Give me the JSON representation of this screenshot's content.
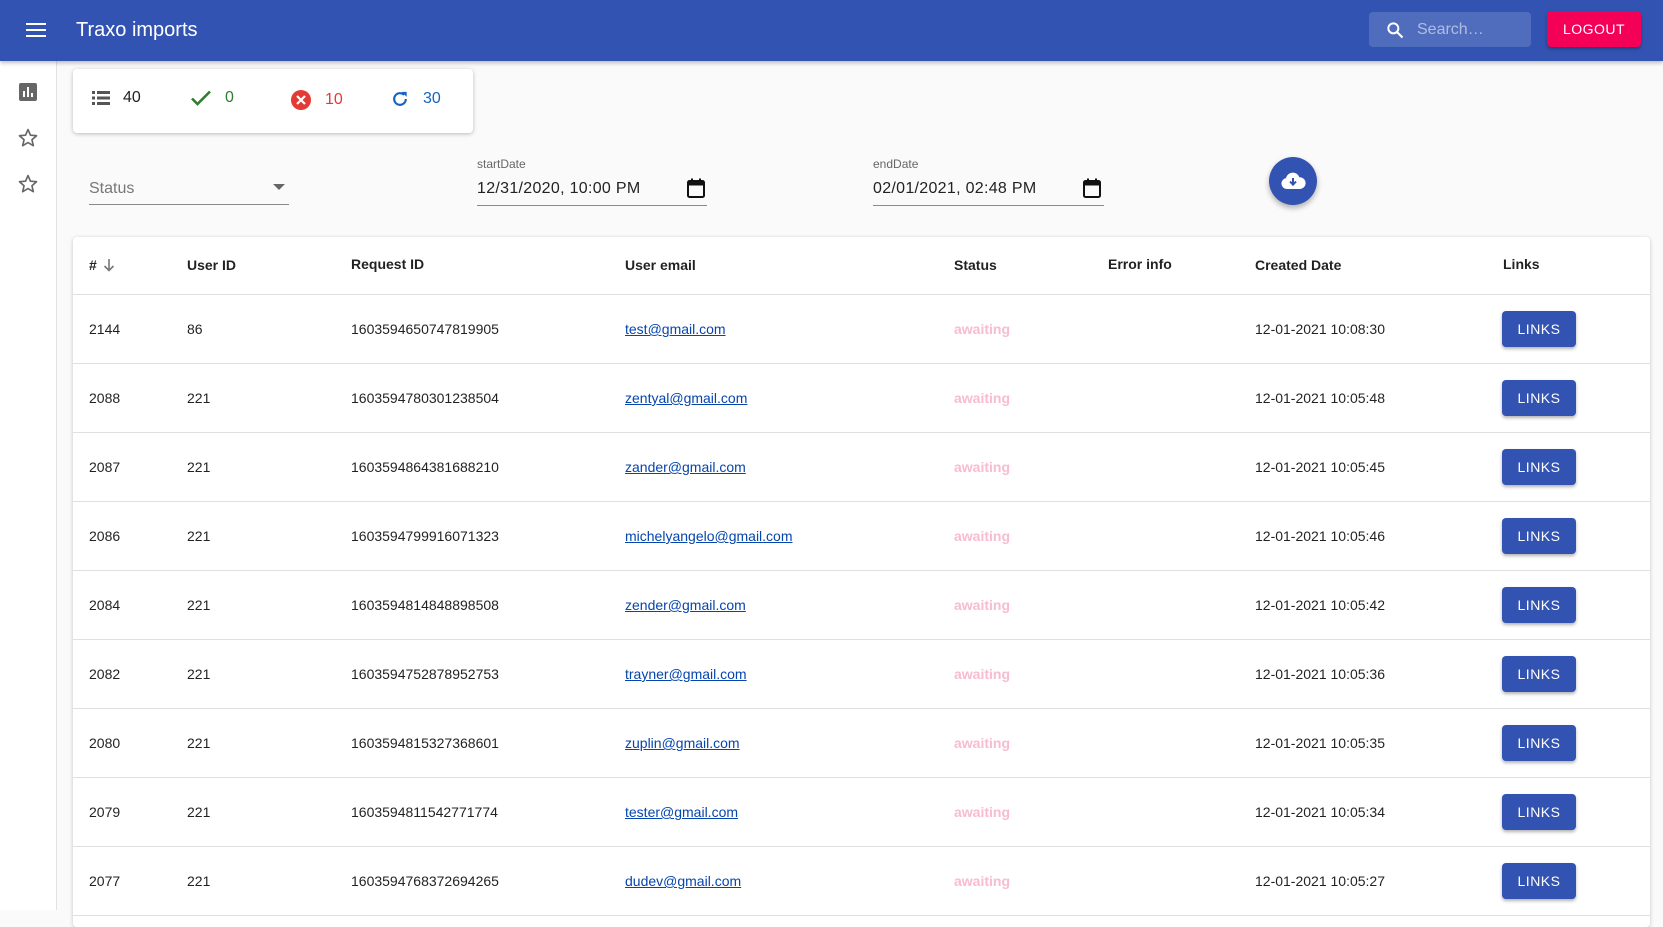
{
  "app": {
    "title": "Traxo imports"
  },
  "search": {
    "placeholder": "Search…"
  },
  "header": {
    "logout_label": "LOGOUT"
  },
  "sidebar": {
    "items": [
      {
        "icon": "bar-chart-icon"
      },
      {
        "icon": "star-outline-icon"
      },
      {
        "icon": "star-outline-icon"
      }
    ]
  },
  "summary": {
    "total": "40",
    "success": "0",
    "failed": "10",
    "pending": "30"
  },
  "colors": {
    "primary": "#3253b1",
    "accent": "#f50057",
    "success": "#2e7d32",
    "error": "#e53935",
    "pending": "#1565c0",
    "awaiting": "#f8bbd0"
  },
  "filters": {
    "status_label": "Status",
    "start_label": "startDate",
    "start_value": "12/31/2020, 10:00 PM",
    "end_label": "endDate",
    "end_value": "02/01/2021, 02:48 PM"
  },
  "table": {
    "headers": {
      "num": "#",
      "user_id": "User ID",
      "request_id": "Request ID",
      "email": "User email",
      "status": "Status",
      "error": "Error info",
      "created": "Created Date",
      "links": "Links"
    },
    "rows": [
      {
        "num": "2144",
        "user_id": "86",
        "request_id": "1603594650747819905",
        "email": "test@gmail.com",
        "status": "awaiting",
        "error": "",
        "created": "12-01-2021 10:08:30",
        "links": "LINKS"
      },
      {
        "num": "2088",
        "user_id": "221",
        "request_id": "1603594780301238504",
        "email": "zentyal@gmail.com",
        "status": "awaiting",
        "error": "",
        "created": "12-01-2021 10:05:48",
        "links": "LINKS"
      },
      {
        "num": "2087",
        "user_id": "221",
        "request_id": "1603594864381688210",
        "email": "zander@gmail.com",
        "status": "awaiting",
        "error": "",
        "created": "12-01-2021 10:05:45",
        "links": "LINKS"
      },
      {
        "num": "2086",
        "user_id": "221",
        "request_id": "1603594799916071323",
        "email": "michelyangelo@gmail.com",
        "status": "awaiting",
        "error": "",
        "created": "12-01-2021 10:05:46",
        "links": "LINKS"
      },
      {
        "num": "2084",
        "user_id": "221",
        "request_id": "1603594814848898508",
        "email": "zender@gmail.com",
        "status": "awaiting",
        "error": "",
        "created": "12-01-2021 10:05:42",
        "links": "LINKS"
      },
      {
        "num": "2082",
        "user_id": "221",
        "request_id": "1603594752878952753",
        "email": "trayner@gmail.com",
        "status": "awaiting",
        "error": "",
        "created": "12-01-2021 10:05:36",
        "links": "LINKS"
      },
      {
        "num": "2080",
        "user_id": "221",
        "request_id": "1603594815327368601",
        "email": "zuplin@gmail.com",
        "status": "awaiting",
        "error": "",
        "created": "12-01-2021 10:05:35",
        "links": "LINKS"
      },
      {
        "num": "2079",
        "user_id": "221",
        "request_id": "1603594811542771774",
        "email": "tester@gmail.com",
        "status": "awaiting",
        "error": "",
        "created": "12-01-2021 10:05:34",
        "links": "LINKS"
      },
      {
        "num": "2077",
        "user_id": "221",
        "request_id": "1603594768372694265",
        "email": "dudev@gmail.com",
        "status": "awaiting",
        "error": "",
        "created": "12-01-2021 10:05:27",
        "links": "LINKS"
      }
    ]
  }
}
